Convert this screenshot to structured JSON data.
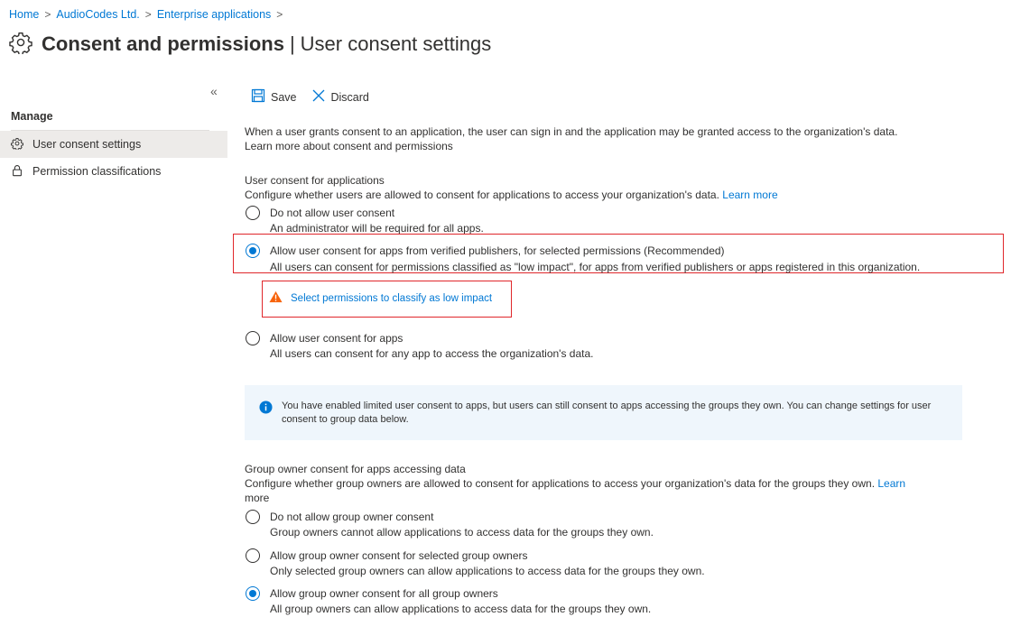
{
  "breadcrumb": {
    "items": [
      "Home",
      "AudioCodes Ltd.",
      "Enterprise applications"
    ],
    "separator": ">"
  },
  "title": {
    "main": "Consent and permissions",
    "separator": "|",
    "sub": "User consent settings",
    "icon": "gear-icon"
  },
  "sidebar": {
    "collapse_glyph": "«",
    "section": "Manage",
    "items": [
      {
        "label": "User consent settings",
        "icon": "gear-icon",
        "active": true
      },
      {
        "label": "Permission classifications",
        "icon": "lock-icon",
        "active": false
      }
    ]
  },
  "toolbar": {
    "save_label": "Save",
    "discard_label": "Discard"
  },
  "intro": {
    "text": "When a user grants consent to an application, the user can sign in and the application may be granted access to the organization's data.",
    "link": "Learn more about consent and permissions"
  },
  "user_consent": {
    "heading": "User consent for applications",
    "description": "Configure whether users are allowed to consent for applications to access your organization's data.",
    "learn_more": "Learn more",
    "options": [
      {
        "label": "Do not allow user consent",
        "detail": "An administrator will be required for all apps.",
        "checked": false
      },
      {
        "label": "Allow user consent for apps from verified publishers, for selected permissions (Recommended)",
        "detail": "All users can consent for permissions classified as \"low impact\", for apps from verified publishers or apps registered in this organization.",
        "checked": true
      },
      {
        "label": "Allow user consent for apps",
        "detail": "All users can consent for any app to access the organization's data.",
        "checked": false
      }
    ],
    "warning_link": "Select permissions to classify as low impact"
  },
  "info_banner": {
    "text": "You have enabled limited user consent to apps, but users can still consent to apps accessing the groups they own. You can change settings for user consent to group data below."
  },
  "group_consent": {
    "heading": "Group owner consent for apps accessing data",
    "description": "Configure whether group owners are allowed to consent for applications to access your organization's data for the groups they own.",
    "learn_more_1": "Learn",
    "learn_more_2": "more",
    "options": [
      {
        "label": "Do not allow group owner consent",
        "detail": "Group owners cannot allow applications to access data for the groups they own.",
        "checked": false
      },
      {
        "label": "Allow group owner consent for selected group owners",
        "detail": "Only selected group owners can allow applications to access data for the groups they own.",
        "checked": false
      },
      {
        "label": "Allow group owner consent for all group owners",
        "detail": "All group owners can allow applications to access data for the groups they own.",
        "checked": true
      }
    ]
  },
  "colors": {
    "accent": "#0078d4",
    "highlight_border": "#e0272b",
    "warning": "#f7630c",
    "info_bg": "#eff6fc"
  }
}
